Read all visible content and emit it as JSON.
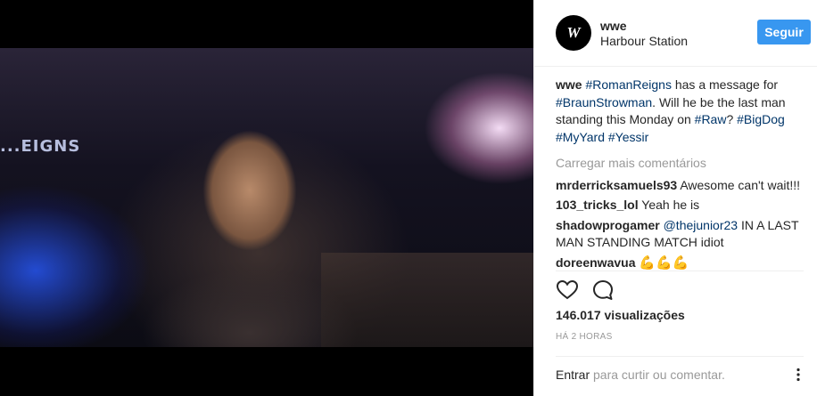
{
  "post": {
    "author": "wwe",
    "location": "Harbour Station",
    "follow_label": "Seguir",
    "avatar_text": "W",
    "media_overlay_text": "...EIGNS"
  },
  "caption": {
    "user": "wwe",
    "text_1": "has a message for",
    "text_2": "Will he be the last man standing this Monday on",
    "text_3": "?",
    "tags": [
      "#RomanReigns",
      "#BraunStrowman",
      "#Raw",
      "#BigDog",
      "#MyYard",
      "#Yessir"
    ]
  },
  "load_more_label": "Carregar mais comentários",
  "comments": [
    {
      "user": "mrderricksamuels93",
      "text": "Awesome can't wait!!!"
    },
    {
      "user": "103_tricks_lol",
      "text": "Yeah he is"
    },
    {
      "user": "shadowprogamer",
      "mention": "@thejunior23",
      "text": "IN A LAST MAN STANDING MATCH idiot"
    },
    {
      "user": "doreenwavua",
      "text": "💪💪💪"
    }
  ],
  "stats": {
    "views": "146.017 visualizações",
    "time": "HÁ 2 HORAS"
  },
  "footer": {
    "login_label": "Entrar",
    "rest": "para curtir ou comentar."
  },
  "icons": {
    "like": "heart-icon",
    "comment": "comment-icon",
    "more": "more-options-icon"
  },
  "colors": {
    "accent": "#3897f0",
    "tag": "#003569",
    "muted": "#999999"
  }
}
